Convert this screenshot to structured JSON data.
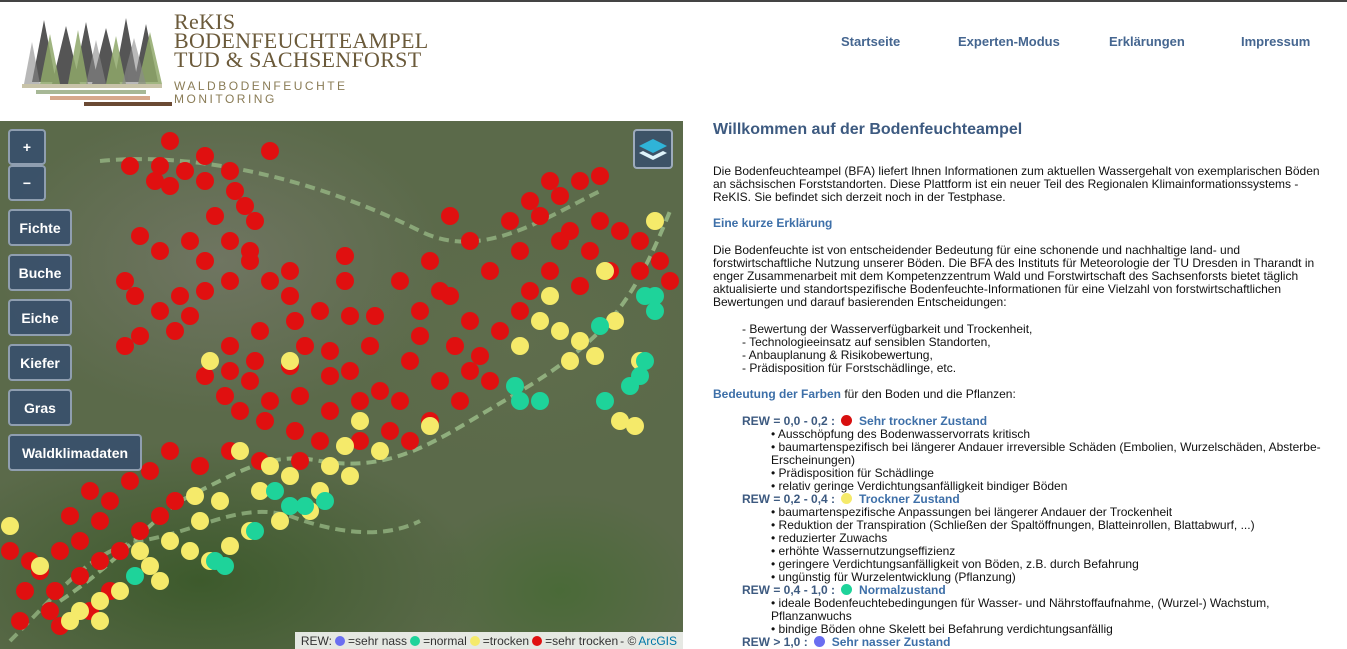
{
  "header": {
    "logo": {
      "title_line1": "ReKIS",
      "title_line2": "BODENFEUCHTEAMPEL",
      "title_line3": "TUD & SACHSENFORST",
      "subtitle_line1": "WALDBODENFEUCHTE",
      "subtitle_line2": "MONITORING"
    },
    "nav": [
      "Startseite",
      "Experten-Modus",
      "Erklärungen",
      "Impressum"
    ]
  },
  "map": {
    "zoom_in": "+",
    "zoom_out": "−",
    "tree_buttons": [
      "Fichte",
      "Buche",
      "Eiche",
      "Kiefer",
      "Gras"
    ],
    "climate_button": "Waldklimadaten",
    "layer_icon": "layers-icon",
    "legend": {
      "prefix": "REW:",
      "items": [
        {
          "label": "=sehr nass",
          "color": "#6a6ef0"
        },
        {
          "label": "=normal",
          "color": "#1ed39a"
        },
        {
          "label": "=trocken",
          "color": "#f5ea6a"
        },
        {
          "label": "=sehr trocken",
          "color": "#e01010"
        }
      ],
      "copyright": "- ©",
      "attribution_link": "ArcGIS"
    },
    "status_colors": {
      "very_dry": "#e01010",
      "dry": "#f5ea6a",
      "normal": "#1ed39a",
      "wet": "#6a6ef0"
    }
  },
  "content": {
    "title": "Willkommen auf der Bodenfeuchteampel",
    "intro": "Die Bodenfeuchteampel (BFA) liefert Ihnen Informationen zum aktuellen Wassergehalt von exemplarischen Böden an sächsischen Forststandorten. Diese Plattform ist ein neuer Teil des Regionalen Klimainformationssystems - ReKIS. Sie befindet sich derzeit noch in der Testphase.",
    "short_heading": "Eine kurze Erklärung",
    "explanation": "Die Bodenfeuchte ist von entscheidender Bedeutung für eine schonende und nachhaltige land- und forstwirtschaftliche Nutzung unserer Böden. Die BFA des Instituts für Meteorologie der TU Dresden in Tharandt in enger Zusammenarbeit mit dem Kompetenzzentrum Wald und Forstwirtschaft des Sachsenforsts bietet täglich aktualisierte und standortspezifische Bodenfeuchte-Informationen für eine Vielzahl von forstwirtschaftlichen Bewertungen und darauf basierenden Entscheidungen:",
    "bullets": [
      "- Bewertung der Wasserverfügbarkeit und Trockenheit,",
      "- Technologieeinsatz auf sensiblen Standorten,",
      "- Anbauplanung & Risikobewertung,",
      "- Prädisposition für Forstschädlinge, etc."
    ],
    "colors_intro_highlight": "Bedeutung der Farben",
    "colors_intro_rest": " für den Boden und die Pflanzen:",
    "rew_levels": [
      {
        "range": "REW = 0,0 - 0,2 :",
        "state": "Sehr trockner Zustand",
        "color": "#d80f0f",
        "items": [
          "• Ausschöpfung des Bodenwasservorrats kritisch",
          "• baumartenspezifisch bei längerer Andauer irreversible Schäden (Embolien, Wurzelschäden, Absterbe-Erscheinungen)",
          "• Prädisposition für Schädlinge",
          "• relativ geringe Verdichtungsanfälligkeit bindiger Böden"
        ]
      },
      {
        "range": "REW = 0,2 - 0,4 :",
        "state": "Trockner Zustand",
        "color": "#f5ea6a",
        "items": [
          "• baumartenspezifische Anpassungen bei längerer Andauer der Trockenheit",
          "• Reduktion der Transpiration (Schließen der Spaltöffnungen, Blatteinrollen, Blattabwurf, ...)",
          "• reduzierter Zuwachs",
          "• erhöhte Wassernutzungseffizienz",
          "• geringere Verdichtungsanfälligkeit von Böden, z.B. durch Befahrung",
          "• ungünstig für Wurzelentwicklung (Pflanzung)"
        ]
      },
      {
        "range": "REW = 0,4 - 1,0 :",
        "state": "Normalzustand",
        "color": "#1ed39a",
        "items": [
          "• ideale Bodenfeuchtebedingungen für Wasser- und Nährstoffaufnahme, (Wurzel-) Wachstum, Pflanzanwuchs",
          "• bindige Böden ohne Skelett bei Befahrung verdichtungsanfällig"
        ]
      },
      {
        "range": "REW > 1,0        :",
        "state": "Sehr nasser Zustand",
        "color": "#6a6ef0",
        "items": []
      }
    ]
  }
}
